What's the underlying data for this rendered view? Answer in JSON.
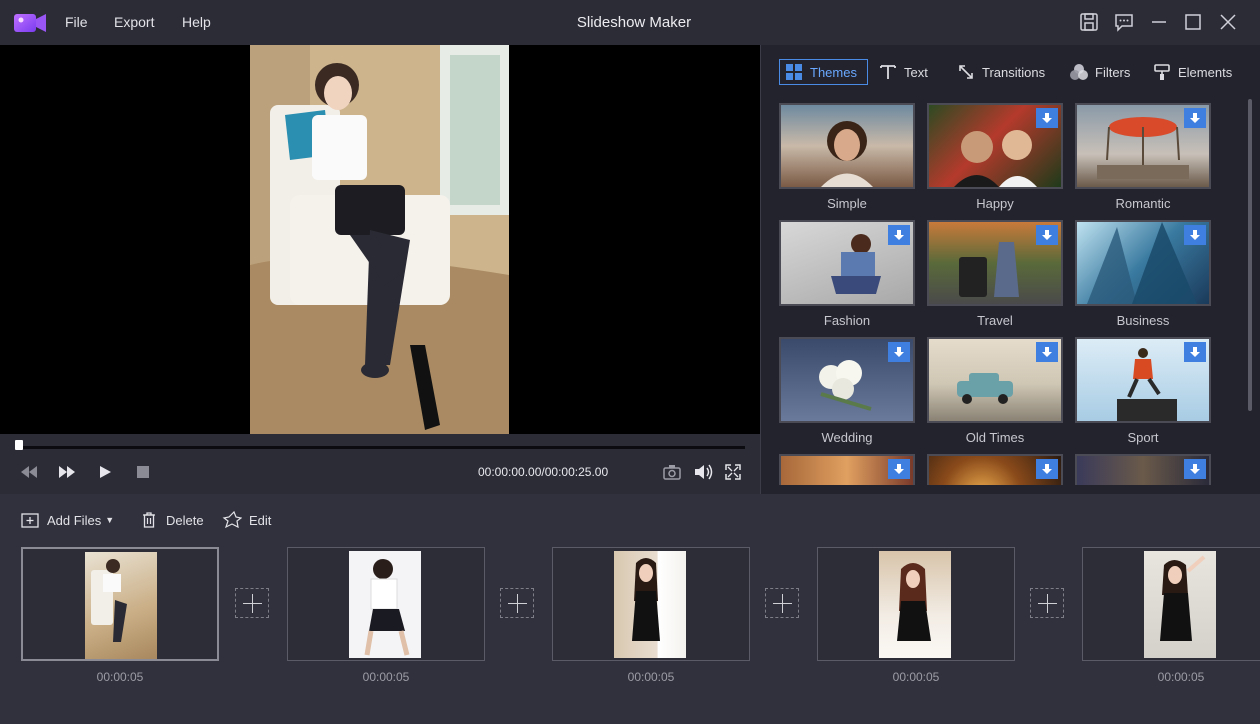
{
  "app": {
    "title": "Slideshow Maker",
    "menu": [
      "File",
      "Export",
      "Help"
    ],
    "accent_color": "#4a8be6",
    "window_controls": [
      "save-icon",
      "feedback-icon",
      "minimize-icon",
      "maximize-icon",
      "close-icon"
    ]
  },
  "player": {
    "timecode": "00:00:00.00/00:00:25.00",
    "progress": 0,
    "controls": [
      "rewind-icon",
      "fast-forward-icon",
      "play-icon",
      "stop-icon",
      "camera-icon",
      "volume-icon",
      "fullscreen-icon"
    ]
  },
  "panel": {
    "tabs": [
      {
        "label": "Themes",
        "icon": "grid-icon",
        "active": true
      },
      {
        "label": "Text",
        "icon": "text-icon",
        "active": false
      },
      {
        "label": "Transitions",
        "icon": "transitions-icon",
        "active": false
      },
      {
        "label": "Filters",
        "icon": "filters-icon",
        "active": false
      },
      {
        "label": "Elements",
        "icon": "elements-icon",
        "active": false
      }
    ],
    "themes": [
      {
        "label": "Simple",
        "download": false
      },
      {
        "label": "Happy",
        "download": true
      },
      {
        "label": "Romantic",
        "download": true
      },
      {
        "label": "Fashion",
        "download": true
      },
      {
        "label": "Travel",
        "download": true
      },
      {
        "label": "Business",
        "download": true
      },
      {
        "label": "Wedding",
        "download": true
      },
      {
        "label": "Old Times",
        "download": true
      },
      {
        "label": "Sport",
        "download": true
      },
      {
        "label": "",
        "download": true
      },
      {
        "label": "",
        "download": true
      },
      {
        "label": "",
        "download": true
      }
    ]
  },
  "timeline": {
    "toolbar": {
      "add_files": "Add Files",
      "delete": "Delete",
      "edit": "Edit"
    },
    "clips": [
      {
        "duration": "00:00:05",
        "selected": true
      },
      {
        "duration": "00:00:05",
        "selected": false
      },
      {
        "duration": "00:00:05",
        "selected": false
      },
      {
        "duration": "00:00:05",
        "selected": false
      },
      {
        "duration": "00:00:05",
        "selected": false
      }
    ]
  }
}
